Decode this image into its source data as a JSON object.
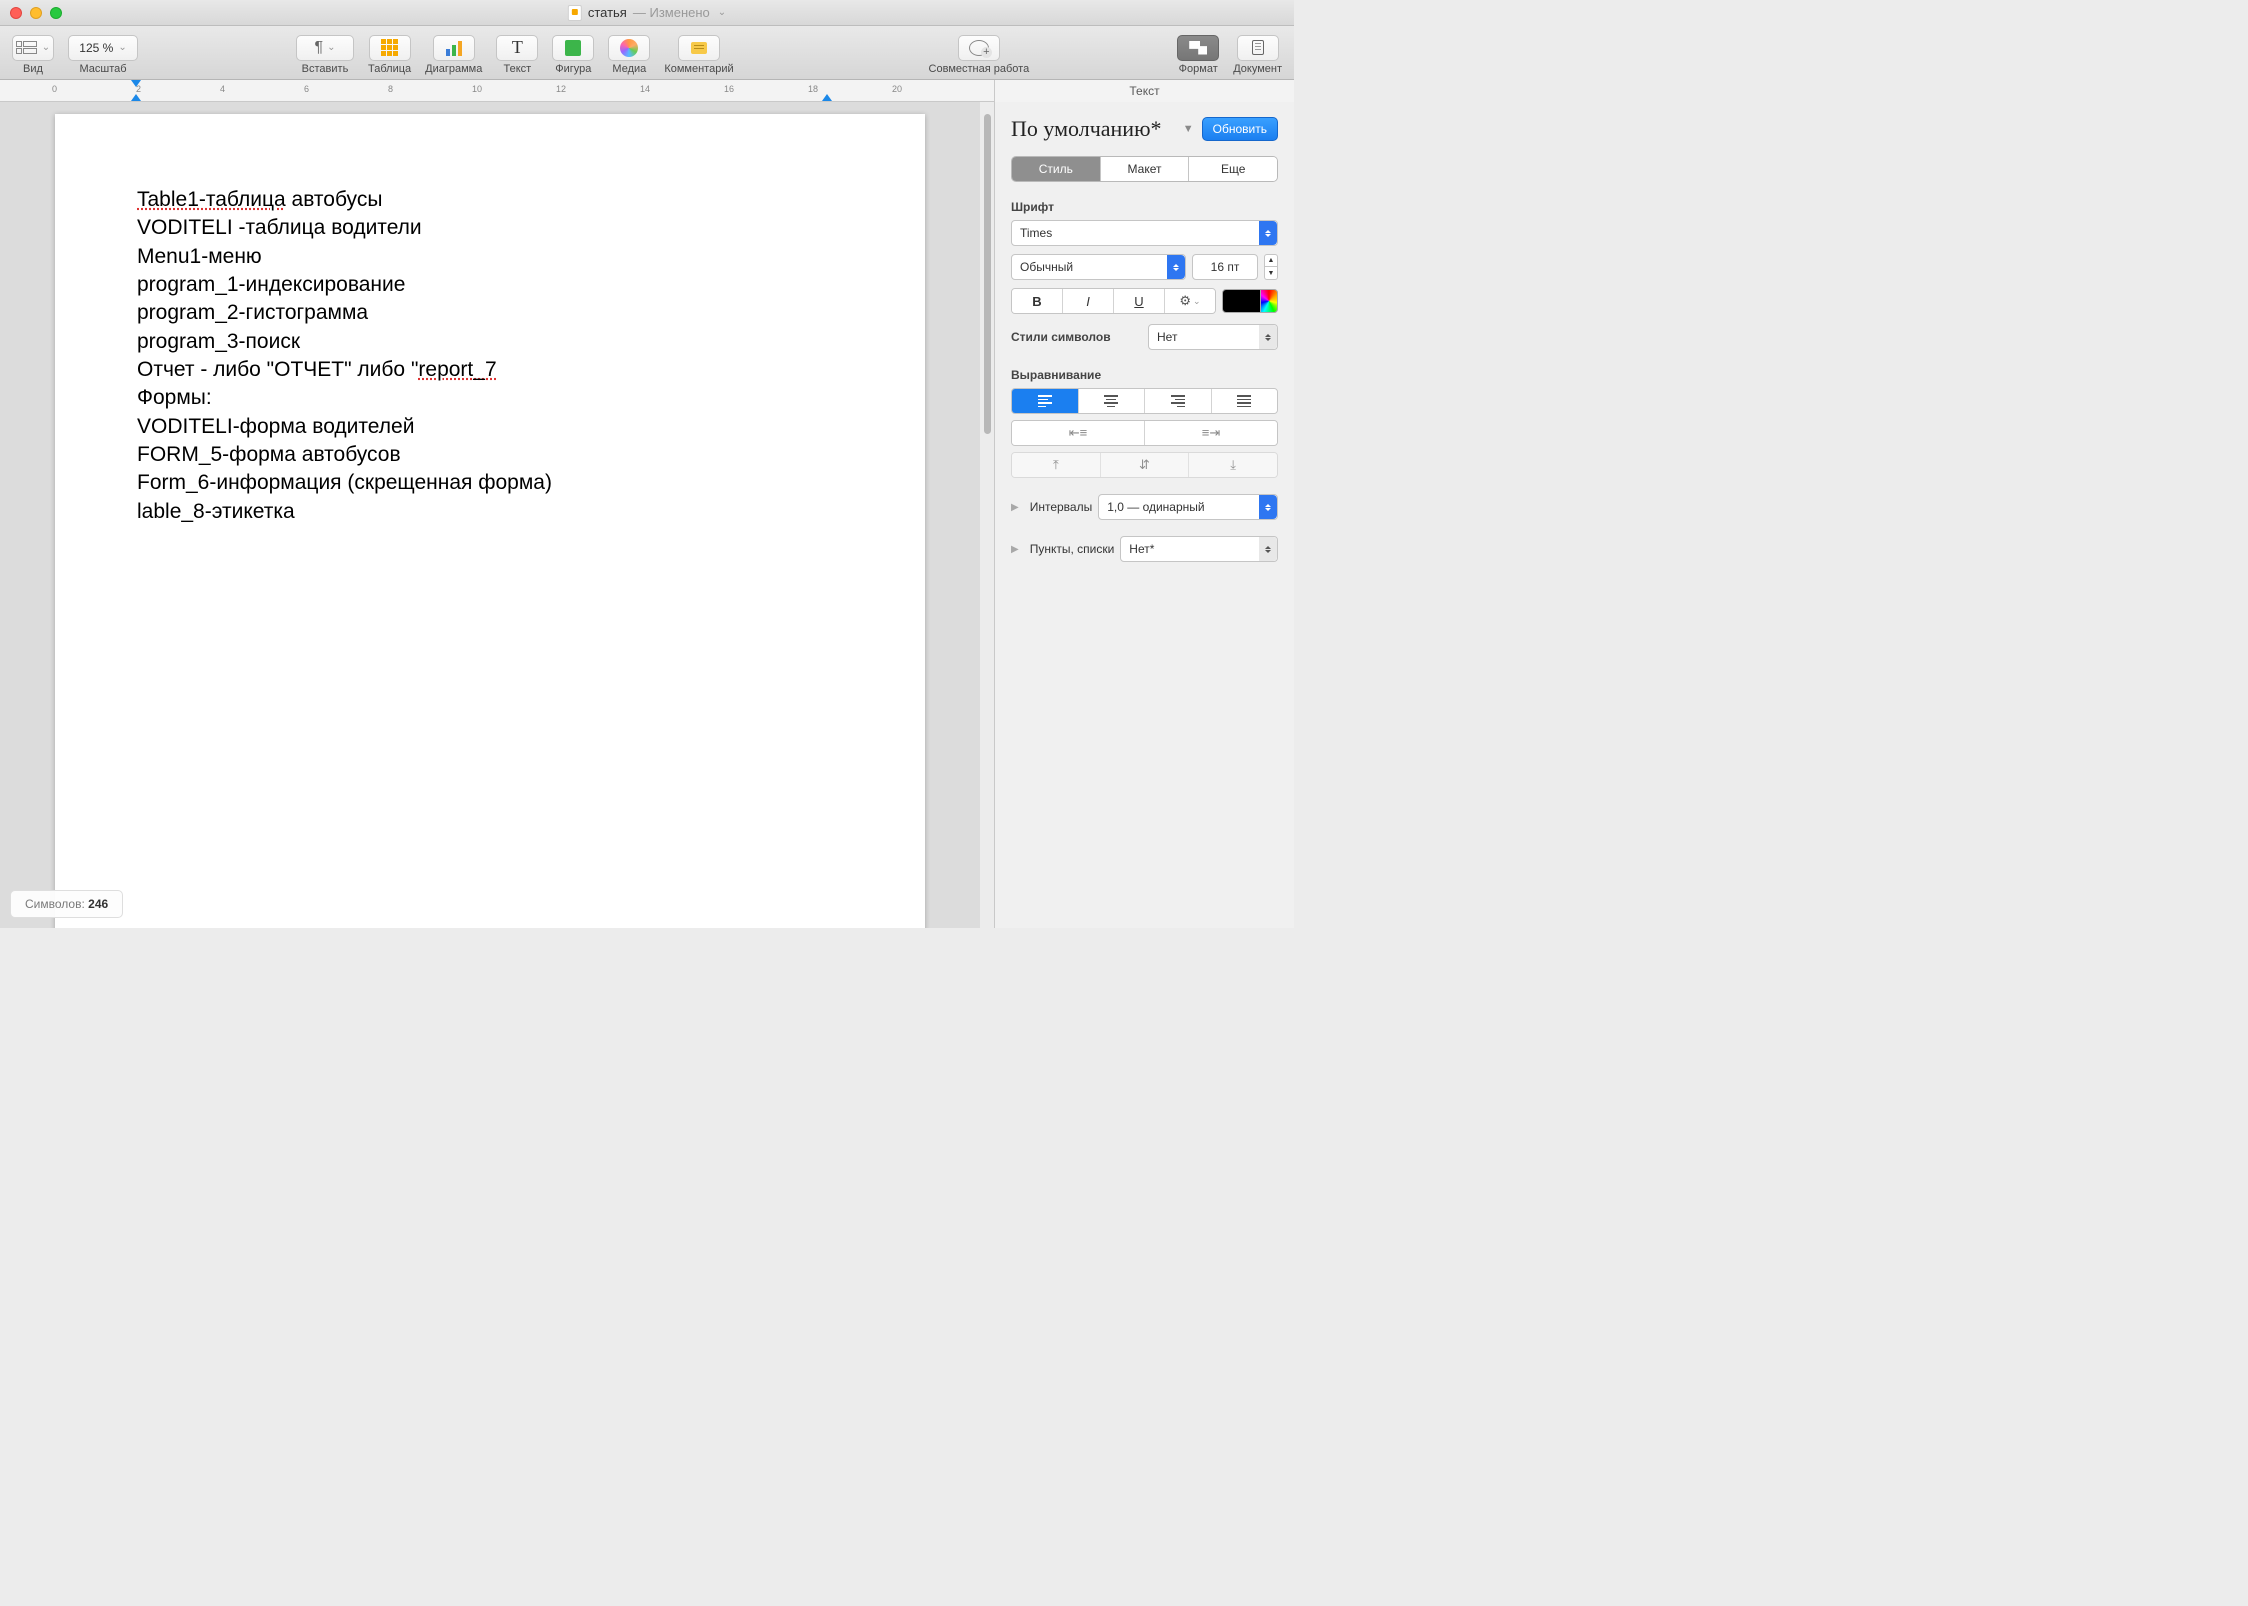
{
  "title": {
    "doc": "статья",
    "status": "Изменено"
  },
  "toolbar": {
    "view": "Вид",
    "zoom_label": "Масштаб",
    "zoom_value": "125 %",
    "insert": "Вставить",
    "table": "Таблица",
    "chart": "Диаграмма",
    "text": "Текст",
    "shape": "Фигура",
    "media": "Медиа",
    "comment": "Комментарий",
    "collaborate": "Совместная работа",
    "format": "Формат",
    "document": "Документ"
  },
  "ruler_numbers": [
    "0",
    "2",
    "4",
    "6",
    "8",
    "10",
    "12",
    "14",
    "16",
    "18",
    "20"
  ],
  "doc_lines": [
    "Table1-таблица автобусы",
    "VODITELI -таблица водители",
    "Menu1-меню",
    "program_1-индексирование",
    "program_2-гистограмма",
    "program_3-поиск",
    "Отчет - либо \"ОТЧЕТ\" либо \"report_7",
    "Формы:",
    "VODITELI-форма водителей",
    "FORM_5-форма автобусов",
    "Form_6-информация (скрещенная форма)",
    "lable_8-этикетка"
  ],
  "inspector": {
    "title": "Текст",
    "style": "По умолчанию*",
    "update_btn": "Обновить",
    "tabs": {
      "style": "Стиль",
      "layout": "Макет",
      "more": "Еще"
    },
    "font_label": "Шрифт",
    "font_family": "Times",
    "font_style": "Обычный",
    "font_size": "16 пт",
    "char_styles_label": "Стили символов",
    "char_styles_value": "Нет",
    "align_label": "Выравнивание",
    "spacing_label": "Интервалы",
    "spacing_value": "1,0 — одинарный",
    "lists_label": "Пункты, списки",
    "lists_value": "Нет*"
  },
  "status": {
    "label": "Символов:",
    "count": "246"
  }
}
